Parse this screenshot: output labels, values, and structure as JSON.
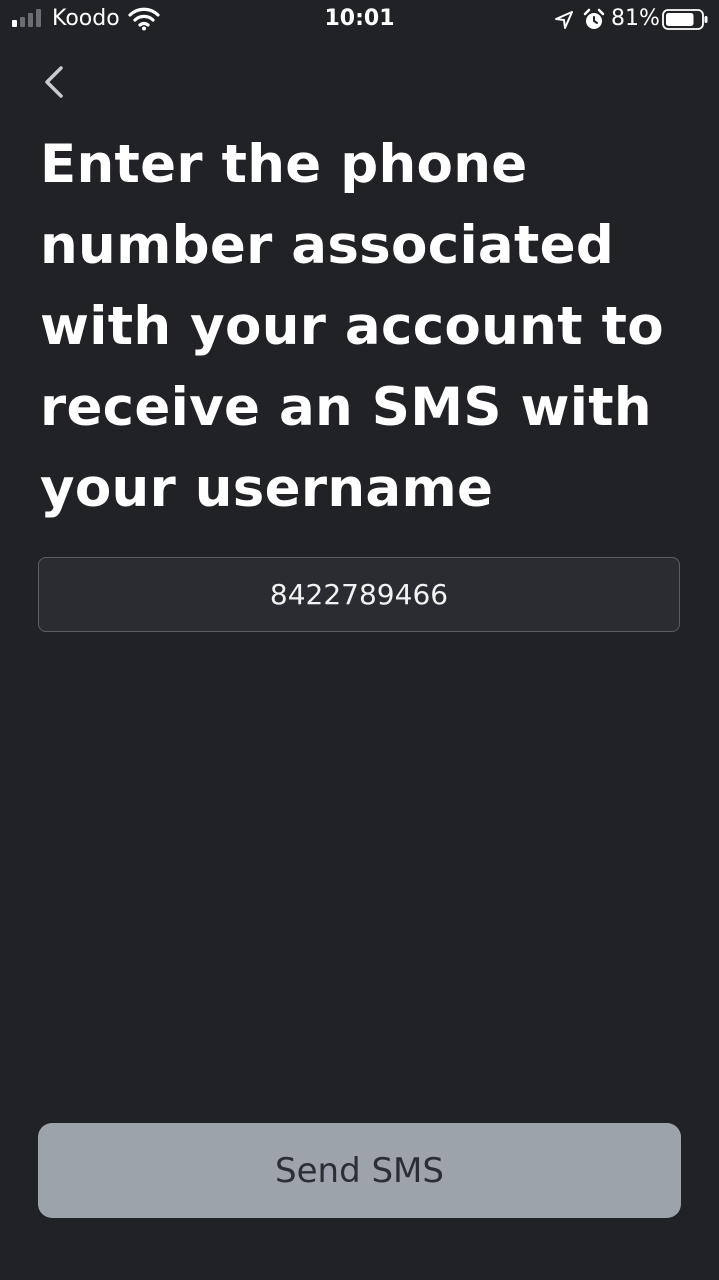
{
  "status_bar": {
    "carrier": "Koodo",
    "time": "10:01",
    "battery_percent": "81%",
    "battery_level": 0.81,
    "signal_bars_active": 1,
    "signal_bars_total": 4,
    "icons": [
      "signal-icon",
      "wifi-icon",
      "location-icon",
      "alarm-icon",
      "battery-icon"
    ]
  },
  "nav": {
    "back_icon": "chevron-left-icon"
  },
  "main": {
    "title": "Enter the phone number associated with your account to receive an SMS with your username",
    "phone_value": "8422789466"
  },
  "footer": {
    "send_label": "Send SMS"
  },
  "colors": {
    "background": "#202226",
    "input_background": "#2a2c31",
    "input_border": "#5a5d63",
    "button_background": "#9da3ab",
    "button_text": "#2b2e33",
    "text": "#ffffff"
  }
}
